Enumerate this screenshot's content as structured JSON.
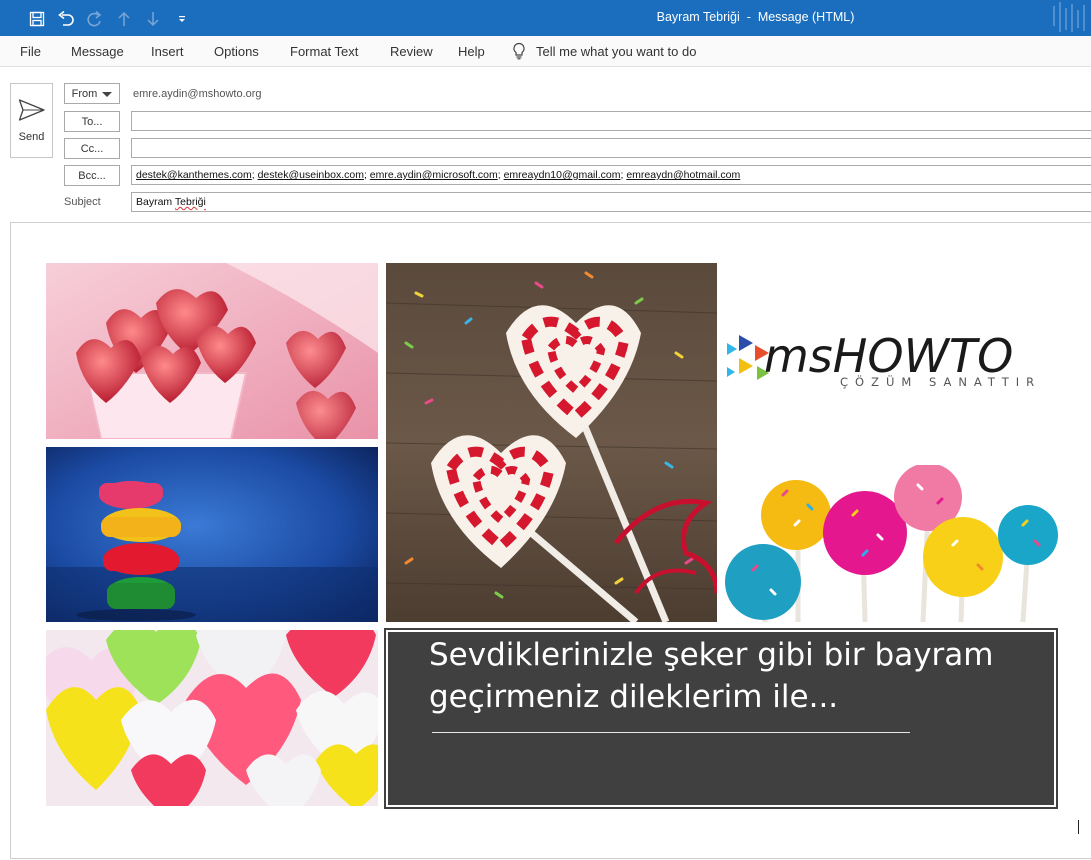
{
  "window": {
    "title": "Bayram Tebriği  -  Message (HTML)"
  },
  "quick_access": [
    {
      "name": "save-icon"
    },
    {
      "name": "undo-icon"
    },
    {
      "name": "redo-icon"
    },
    {
      "name": "up-arrow-icon"
    },
    {
      "name": "down-arrow-icon"
    },
    {
      "name": "customize-qat-icon"
    }
  ],
  "ribbon": {
    "tabs": [
      "File",
      "Message",
      "Insert",
      "Options",
      "Format Text",
      "Review",
      "Help"
    ],
    "tell_me": "Tell me what you want to do"
  },
  "compose": {
    "send_label": "Send",
    "from_label": "From",
    "from_address": "emre.aydin@mshowto.org",
    "to_label": "To...",
    "cc_label": "Cc...",
    "bcc_label": "Bcc...",
    "to_value": "",
    "cc_value": "",
    "bcc_recipients": [
      "destek@kanthemes.com",
      "destek@useinbox.com",
      "emre.aydin@microsoft.com",
      "emreaydn10@gmail.com",
      "emreaydn@hotmail.com"
    ],
    "subject_label": "Subject",
    "subject_value_plain": "Bayram ",
    "subject_value_flagged": "Tebriği"
  },
  "body": {
    "logo": {
      "brand": "msHOWTO",
      "tagline": "ÇÖZÜM SANATTIR"
    },
    "message_line1": "Sevdiklerinizle şeker gibi bir bayram",
    "message_line2": "geçirmeniz dileklerim ile...",
    "images": [
      {
        "name": "jelly-candies-cup-image"
      },
      {
        "name": "heart-lollipops-image"
      },
      {
        "name": "stacked-candies-image"
      },
      {
        "name": "cake-pops-image"
      },
      {
        "name": "heart-gummies-image"
      }
    ]
  },
  "colors": {
    "titlebar": "#1a6ebd",
    "message_box": "#404040",
    "ribbon_bg": "#fafafa"
  }
}
